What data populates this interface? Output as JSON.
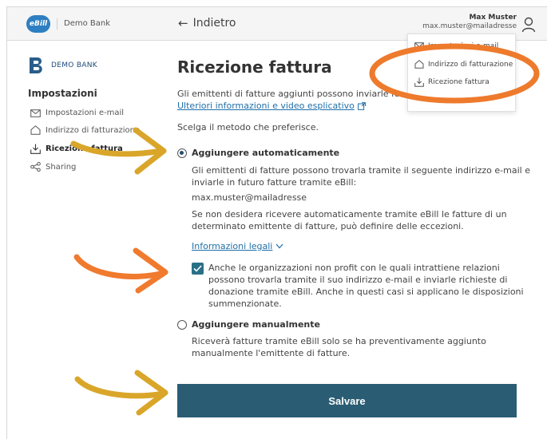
{
  "topbar": {
    "logo_text": "eBill",
    "bank_name": "Demo Bank",
    "back_label": "Indietro",
    "user_name": "Max Muster",
    "user_email": "max.muster@mailadresse"
  },
  "dropdown": {
    "items": [
      {
        "label": "Impostazioni e-mail",
        "icon": "envelope-icon"
      },
      {
        "label": "Indirizzo di fatturazione",
        "icon": "home-icon"
      },
      {
        "label": "Ricezione fattura",
        "icon": "download-icon"
      }
    ]
  },
  "sidebar": {
    "logo_text": "DEMO BANK",
    "title": "Impostazioni",
    "items": [
      {
        "label": "Impostazioni e-mail",
        "icon": "envelope-icon",
        "active": false
      },
      {
        "label": "Indirizzo di fatturazione",
        "icon": "home-icon",
        "active": false
      },
      {
        "label": "Ricezione fattura",
        "icon": "download-icon",
        "active": true
      },
      {
        "label": "Sharing",
        "icon": "share-icon",
        "active": false
      }
    ]
  },
  "main": {
    "title": "Ricezione fattura",
    "intro": "Gli emittenti di fatture aggiunti possono inviarle fo",
    "info_link": "Ulteriori informazioni e video esplicativo",
    "choose_method": "Scelga il metodo che preferisce.",
    "option_auto": {
      "label": "Aggiungere automaticamente",
      "selected": true,
      "desc_line1": "Gli emittenti di fatture possono trovarla tramite il seguente indirizzo e-mail e",
      "desc_line2": "inviarle in futuro fatture tramite eBill:",
      "email": "max.muster@mailadresse",
      "exc_line1": "Se non desidera ricevere automaticamente tramite eBill le fatture di un",
      "exc_line2": "determinato emittente di fatture, può definire delle eccezioni.",
      "legal_link": "Informazioni legali",
      "checkbox_checked": true,
      "checkbox_line1": "Anche le organizzazioni non profit con le quali intrattiene relazioni",
      "checkbox_line2": "possono trovarla tramite il suo indirizzo e-mail e inviarle richieste di",
      "checkbox_line3": "donazione tramite eBill. Anche in questi casi si applicano le disposizioni",
      "checkbox_line4": "summenzionate."
    },
    "option_manual": {
      "label": "Aggiungere manualmente",
      "selected": false,
      "desc_line1": "Riceverà fatture tramite eBill solo se ha preventivamente aggiunto",
      "desc_line2": "manualmente l'emittente di fatture."
    },
    "save_label": "Salvare"
  },
  "annotation_colors": {
    "arrow_gold": "#d9a62a",
    "arrow_orange": "#f07a2e",
    "circle_orange": "#ee7a2c"
  }
}
